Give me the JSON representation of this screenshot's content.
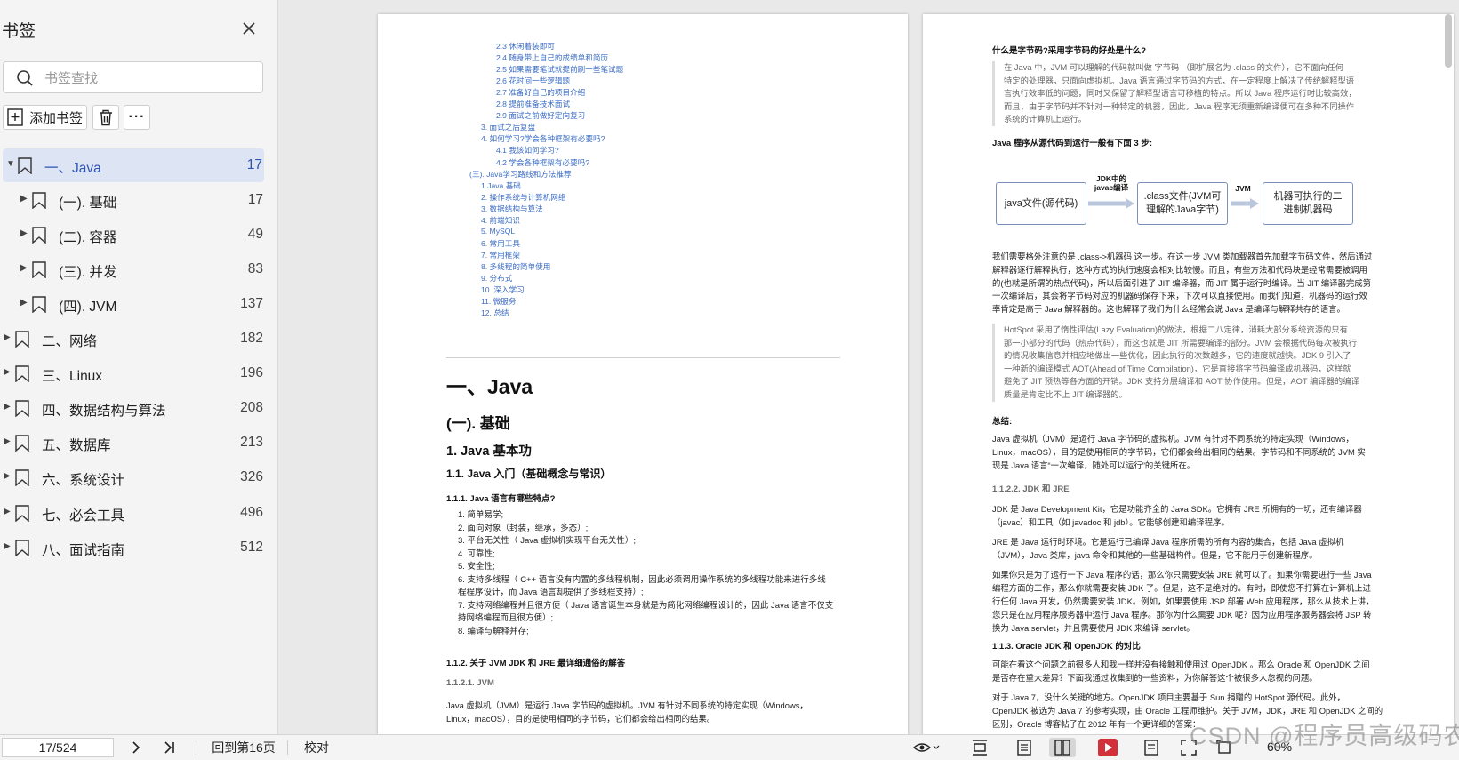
{
  "sidebar": {
    "title": "书签",
    "search_placeholder": "书签查找",
    "add_label": "添加书签",
    "items": [
      {
        "label": "一、Java",
        "page": "17",
        "expanded": true,
        "level": 0
      },
      {
        "label": "(一). 基础",
        "page": "17",
        "level": 1
      },
      {
        "label": "(二). 容器",
        "page": "49",
        "level": 1
      },
      {
        "label": "(三). 并发",
        "page": "83",
        "level": 1
      },
      {
        "label": "(四). JVM",
        "page": "137",
        "level": 1
      },
      {
        "label": "二、网络",
        "page": "182",
        "level": 0
      },
      {
        "label": "三、Linux",
        "page": "196",
        "level": 0
      },
      {
        "label": "四、数据结构与算法",
        "page": "208",
        "level": 0
      },
      {
        "label": "五、数据库",
        "page": "213",
        "level": 0
      },
      {
        "label": "六、系统设计",
        "page": "326",
        "level": 0
      },
      {
        "label": "七、必会工具",
        "page": "496",
        "level": 0
      },
      {
        "label": "八、面试指南",
        "page": "512",
        "level": 0
      }
    ]
  },
  "page1": {
    "toc": [
      "2.3 休闲着装即可",
      "2.4 随身带上自己的成绩单和简历",
      "2.5 如果需要笔试就提前刷一些笔试题",
      "2.6 花时间一些逻辑题",
      "2.7 准备好自己的项目介绍",
      "2.8 提前准备技术面试",
      "2.9 面试之前做好定向复习",
      "3. 面试之后复盘",
      "4. 如何学习?学会各种框架有必要吗?",
      "4.1 我该如何学习?",
      "4.2 学会各种框架有必要吗?",
      "(三). Java学习路线和方法推荐",
      "1.Java 基础",
      "2. 操作系统与计算机网络",
      "3. 数据结构与算法",
      "4. 前端知识",
      "5. MySQL",
      "6. 常用工具",
      "7. 常用框架",
      "8. 多线程的简单使用",
      "9. 分布式",
      "10. 深入学习",
      "11. 微服务",
      "12. 总结"
    ],
    "h1": "一、Java",
    "h2": "(一). 基础",
    "h3": "1. Java 基本功",
    "h4": "1.1. Java 入门（基础概念与常识）",
    "h5a": "1.1.1. Java 语言有哪些特点?",
    "features": [
      "1. 简单易学;",
      "2. 面向对象（封装，继承，多态）;",
      "3. 平台无关性（ Java 虚拟机实现平台无关性）;",
      "4. 可靠性;",
      "5. 安全性;",
      "6. 支持多线程（ C++ 语言没有内置的多线程机制，因此必须调用操作系统的多线程功能来进行多线",
      "    程程序设计，而 Java 语言却提供了多线程支持）;",
      "7. 支持网络编程并且很方便（ Java 语言诞生本身就是为简化网络编程设计的，因此 Java 语言不仅支",
      "    持网络编程而且很方便）;",
      "8. 编译与解释并存;"
    ],
    "h5b": "1.1.2. 关于 JVM JDK 和 JRE 最详细通俗的解答",
    "h6a": "1.1.2.1. JVM",
    "para": "Java 虚拟机（JVM）是运行 Java 字节码的虚拟机。JVM 有针对不同系统的特定实现（Windows，\nLinux，macOS），目的是使用相同的字节码，它们都会给出相同的结果。"
  },
  "page2": {
    "q_title": "什么是字节码?采用字节码的好处是什么?",
    "quote1": "在 Java 中，JVM 可以理解的代码就叫做 字节码 （即扩展名为 .class 的文件），它不面向任何\n特定的处理器，只面向虚拟机。Java 语言通过字节码的方式，在一定程度上解决了传统解释型语\n言执行效率低的问题，同时又保留了解释型语言可移植的特点。所以 Java 程序运行时比较高效，\n而且，由于字节码并不针对一种特定的机器，因此，Java 程序无须重新编译便可在多种不同操作\n系统的计算机上运行。",
    "steps_title": "Java 程序从源代码到运行一般有下面 3 步:",
    "diagram": {
      "box1": "java文件(源代码)",
      "arrow1": "JDK中的\njavac编译",
      "box2": ".class文件(JVM可\n理解的Java字节)",
      "arrow2": "JVM",
      "box3": "机器可执行的二\n进制机器码"
    },
    "para1": "我们需要格外注意的是 .class->机器码 这一步。在这一步 JVM 类加载器首先加载字节码文件，然后通过\n解释器逐行解释执行，这种方式的执行速度会相对比较慢。而且，有些方法和代码块是经常需要被调用\n的(也就是所谓的热点代码)，所以后面引进了 JIT 编译器，而 JIT 属于运行时编译。当 JIT 编译器完成第\n一次编译后，其会将字节码对应的机器码保存下来，下次可以直接使用。而我们知道，机器码的运行效\n率肯定是高于 Java 解释器的。这也解释了我们为什么经常会说 Java 是编译与解释共存的语言。",
    "quote2": "HotSpot 采用了惰性评估(Lazy Evaluation)的做法，根据二八定律，消耗大部分系统资源的只有\n那一小部分的代码（热点代码），而这也就是 JIT 所需要编译的部分。JVM 会根据代码每次被执行\n的情况收集信息并相应地做出一些优化，因此执行的次数越多，它的速度就越快。JDK 9 引入了\n一种新的编译模式 AOT(Ahead of Time Compilation)，它是直接将字节码编译成机器码，这样就\n避免了 JIT 预热等各方面的开销。JDK 支持分层编译和 AOT 协作使用。但是，AOT 编译器的编译\n质量是肯定比不上 JIT 编译器的。",
    "summary_title": "总结:",
    "para2": "Java 虚拟机（JVM）是运行 Java 字节码的虚拟机。JVM 有针对不同系统的特定实现（Windows，\nLinux，macOS），目的是使用相同的字节码，它们都会给出相同的结果。字节码和不同系统的 JVM 实\n现是 Java 语言“一次编译，随处可以运行”的关键所在。",
    "h6b": "1.1.2.2. JDK 和 JRE",
    "para3": "JDK 是 Java Development Kit，它是功能齐全的 Java SDK。它拥有 JRE 所拥有的一切，还有编译器\n（javac）和工具（如 javadoc 和 jdb）。它能够创建和编译程序。",
    "para4": "JRE 是 Java 运行时环境。它是运行已编译 Java 程序所需的所有内容的集合，包括 Java 虚拟机\n（JVM），Java 类库，java 命令和其他的一些基础构件。但是，它不能用于创建新程序。",
    "para5": "如果你只是为了运行一下 Java 程序的话，那么你只需要安装 JRE 就可以了。如果你需要进行一些 Java\n编程方面的工作，那么你就需要安装 JDK 了。但是，这不是绝对的。有时，即使您不打算在计算机上进\n行任何 Java 开发，仍然需要安装 JDK。例如，如果要使用 JSP 部署 Web 应用程序，那么从技术上讲，\n您只是在应用程序服务器中运行 Java 程序。那你为什么需要 JDK 呢？因为应用程序服务器会将 JSP 转\n换为 Java servlet，并且需要使用 JDK 来编译 servlet。",
    "h5c": "1.1.3. Oracle JDK 和 OpenJDK 的对比",
    "para6": "可能在看这个问题之前很多人和我一样并没有接触和使用过 OpenJDK 。那么 Oracle 和 OpenJDK 之间\n是否存在重大差异？下面我通过收集到的一些资料，为你解答这个被很多人忽视的问题。",
    "para7": "对于 Java 7，没什么关键的地方。OpenJDK 项目主要基于 Sun 捐赠的 HotSpot 源代码。此外，\nOpenJDK 被选为 Java 7 的参考实现，由 Oracle 工程师维护。关于 JVM，JDK，JRE 和 OpenJDK 之间的\n区别，Oracle 博客帖子在 2012 年有一个更详细的答案："
  },
  "statusbar": {
    "page_indicator": "17/524",
    "back_label": "回到第16页",
    "proof_label": "校对",
    "zoom": "60%"
  },
  "watermark": "CSDN @程序员高级码农"
}
